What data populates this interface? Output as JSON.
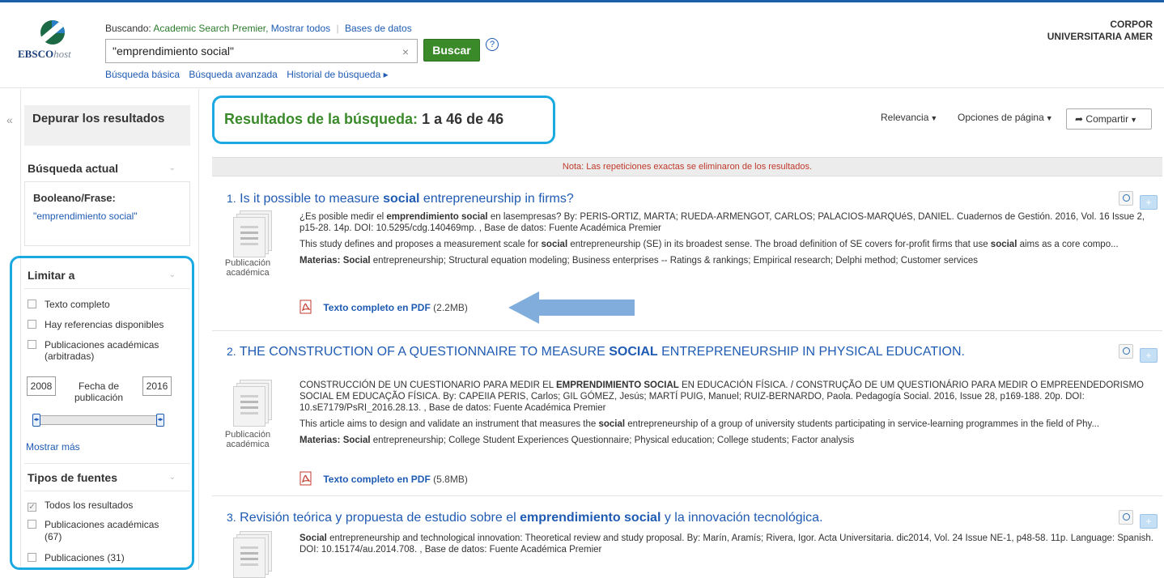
{
  "header": {
    "searching_label": "Buscando:",
    "database": "Academic Search Premier,",
    "show_all": "Mostrar todos",
    "databases_link": "Bases de datos",
    "query": "\"emprendimiento social\"",
    "search_button": "Buscar",
    "help": "?",
    "basic_search": "Búsqueda básica",
    "advanced_search": "Búsqueda avanzada",
    "history": "Historial de búsqueda ▸",
    "org_line1": "CORPOR",
    "org_line2": "UNIVERSITARIA AMER",
    "logo_text": "EBSCO",
    "logo_text_italic": "host"
  },
  "sidebar": {
    "collapse": "«",
    "refine_title": "Depurar los resultados",
    "current_search": "Búsqueda actual",
    "boolean_label": "Booleano/Frase:",
    "boolean_value": "\"emprendimiento social\"",
    "limit_to": "Limitar a",
    "limits": [
      "Texto completo",
      "Hay referencias disponibles",
      "Publicaciones académicas",
      "(arbitradas)"
    ],
    "date_from": "2008",
    "date_to": "2016",
    "date_label1": "Fecha de",
    "date_label2": "publicación",
    "show_more": "Mostrar más",
    "source_types": "Tipos de fuentes",
    "sources": [
      "Todos los resultados",
      "Publicaciones académicas",
      "(67)",
      "Publicaciones (31)"
    ]
  },
  "main": {
    "results_label": "Resultados de la búsqueda:",
    "results_range": "1 a 46 de 46",
    "relevance": "Relevancia",
    "page_options": "Opciones de página",
    "share": "Compartir",
    "note": "Nota: Las repeticiones exactas se eliminaron de los resultados."
  },
  "results": [
    {
      "num": "1.",
      "title_a": "Is it possible to measure ",
      "title_b": "social",
      "title_c": " entrepreneurship in firms?",
      "type1": "Publicación",
      "type2": "académica",
      "cite_a": "¿Es posible medir el ",
      "cite_b": "emprendimiento social",
      "cite_c": " en lasempresas? By: PERIS-ORTIZ, MARTA; RUEDA-ARMENGOT, CARLOS; PALACIOS-MARQUéS, DANIEL. Cuadernos de Gestión. 2016, Vol. 16 Issue 2, p15-28. 14p. DOI: 10.5295/cdg.140469mp. , Base de datos: Fuente Académica Premier",
      "abs_a": "This study defines and proposes a measurement scale for ",
      "abs_b": "social",
      "abs_c": " entrepreneurship (SE) in its broadest sense. The broad definition of SE covers for-profit firms that use ",
      "abs_d": "social",
      "abs_e": " aims as a core compo...",
      "subj_label": "Materias:",
      "subj_b": "Social",
      "subj_rest": " entrepreneurship; Structural equation modeling; Business enterprises -- Ratings & rankings; Empirical research; Delphi method; Customer services",
      "pdf": "Texto completo en PDF",
      "pdf_size": "(2.2MB)"
    },
    {
      "num": "2.",
      "title_a": "THE CONSTRUCTION OF A QUESTIONNAIRE TO MEASURE ",
      "title_b": "SOCIAL",
      "title_c": " ENTREPRENEURSHIP IN PHYSICAL EDUCATION.",
      "type1": "Publicación",
      "type2": "académica",
      "cite_a": "CONSTRUCCIÓN DE UN CUESTIONARIO PARA MEDIR EL ",
      "cite_b": "EMPRENDIMIENTO SOCIAL",
      "cite_c": " EN EDUCACIÓN FÍSICA. / CONSTRUÇÃO DE UM QUESTIONÁRIO PARA MEDIR O EMPREENDEDORISMO SOCIAL EM EDUCAÇÃO FÍSICA. By: CAPEIIA PERIS, Carlos; GIL GÓMEZ, Jesús; MARTÍ PUIG, Manuel; RUIZ-BERNARDO, Paola. Pedagogía Social. 2016, Issue 28, p169-188. 20p. DOI: 10.sE7179/PsRI_2016.28.13. , Base de datos: Fuente Académica Premier",
      "abs_a": "This article aims to design and validate an instrument that measures the ",
      "abs_b": "social",
      "abs_c": " entrepreneurship of a group of university students participating in service-learning programmes in the field of Phy...",
      "subj_label": "Materias:",
      "subj_b": "Social",
      "subj_rest": " entrepreneurship; College Student Experiences Questionnaire; Physical education; College students; Factor analysis",
      "pdf": "Texto completo en PDF",
      "pdf_size": "(5.8MB)"
    },
    {
      "num": "3.",
      "title_a": "Revisión teórica y propuesta de estudio sobre el ",
      "title_b": "emprendimiento social",
      "title_c": " y la innovación tecnológica.",
      "cite_a": "",
      "cite_b": "Social",
      "cite_c": " entrepreneurship and technological innovation: Theoretical review and study proposal. By: Marín, Aramís; Rivera, Igor. Acta Universitaria. dic2014, Vol. 24 Issue NE-1, p48-58. 11p. Language: Spanish. DOI: 10.15174/au.2014.708. , Base de datos: Fuente Académica Premier"
    }
  ],
  "colors": {
    "accent_blue": "#1aa9e1",
    "link": "#1f5bb3",
    "green": "#3a8a2a",
    "note_red": "#c0392b"
  }
}
